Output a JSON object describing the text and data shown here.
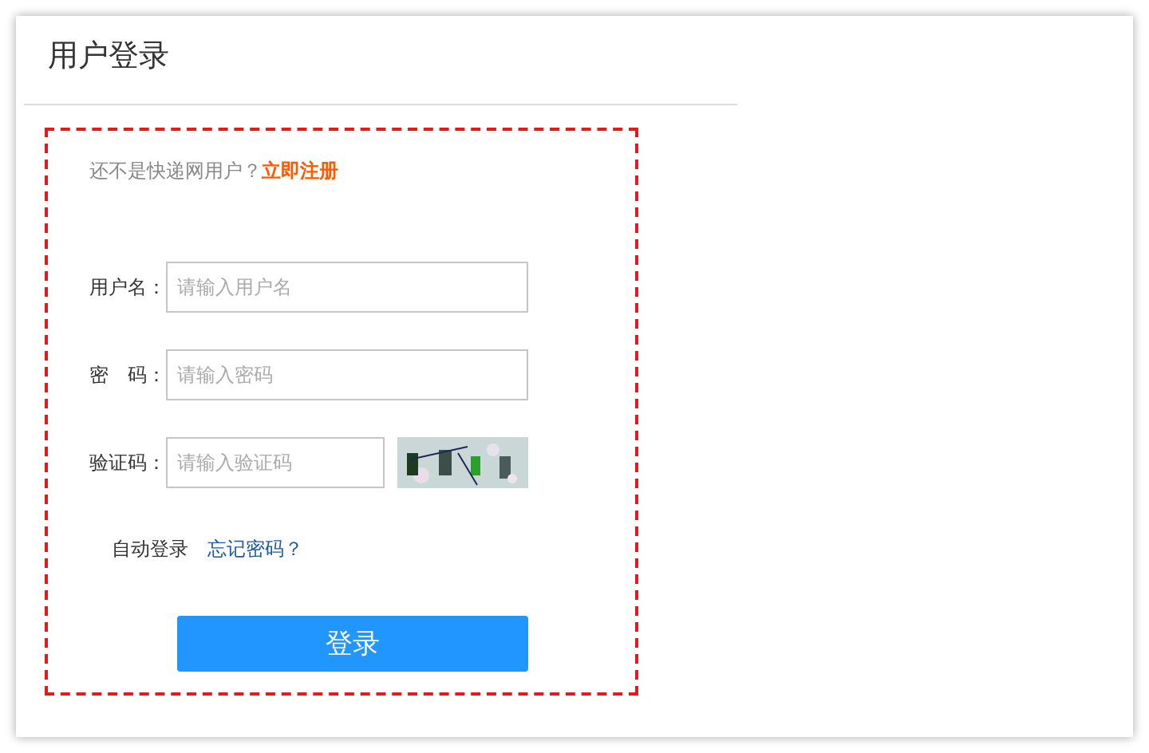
{
  "title": "用户登录",
  "register": {
    "prompt": "还不是快递网用户？",
    "link": "立即注册"
  },
  "fields": [
    {
      "label": "用户名：",
      "placeholder": "请输入用户名",
      "kind": "text"
    },
    {
      "label": "密　码：",
      "placeholder": "请输入密码",
      "kind": "password"
    },
    {
      "label": "验证码：",
      "placeholder": "请输入验证码",
      "kind": "captcha"
    }
  ],
  "auto_login": "自动登录",
  "forgot": "忘记密码？",
  "submit": "登录"
}
